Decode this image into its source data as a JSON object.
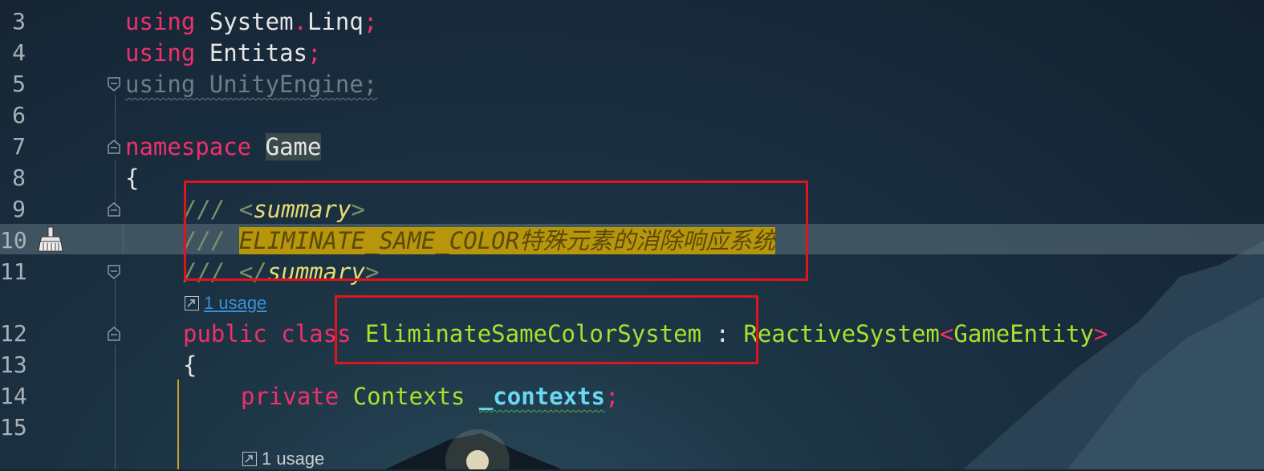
{
  "editor": {
    "lines": [
      {
        "num": "3",
        "tokens": {
          "kw": "using",
          "ns1": "System",
          "dot": ".",
          "ns2": "Linq",
          "semi": ";"
        }
      },
      {
        "num": "4",
        "tokens": {
          "kw": "using",
          "ns1": "Entitas",
          "semi": ";"
        }
      },
      {
        "num": "5",
        "text": "using UnityEngine;"
      },
      {
        "num": "6"
      },
      {
        "num": "7",
        "tokens": {
          "kw": "namespace",
          "name": "Game"
        }
      },
      {
        "num": "8",
        "text": "{"
      },
      {
        "num": "9",
        "tokens": {
          "slashes": "///",
          "open": "<",
          "tag": "summary",
          "close": ">"
        }
      },
      {
        "num": "10",
        "tokens": {
          "slashes": "///",
          "doc_en": "ELIMINATE_SAME_COLOR",
          "doc_cn": "特殊元素的消除响应系统"
        }
      },
      {
        "num": "11",
        "tokens": {
          "slashes": "///",
          "open": "</",
          "tag": "summary",
          "close": ">"
        }
      },
      {
        "num": "12",
        "tokens": {
          "kw1": "public",
          "kw2": "class",
          "name": "EliminateSameColorSystem",
          "colon": ":",
          "base": "ReactiveSystem",
          "lt": "<",
          "generic": "GameEntity",
          "gt": ">"
        }
      },
      {
        "num": "13",
        "text": "{"
      },
      {
        "num": "14",
        "tokens": {
          "kw": "private",
          "type": "Contexts",
          "field": "_contexts",
          "semi": ";"
        }
      },
      {
        "num": "15"
      }
    ],
    "usage_hints": [
      {
        "label": "1 usage"
      },
      {
        "label": "1 usage"
      }
    ]
  },
  "colors": {
    "keyword": "#f0306a",
    "type": "#a6e22e",
    "doc_highlight": "#b8960c",
    "annotation_box": "#e0141c",
    "link": "#3b8ed8"
  }
}
